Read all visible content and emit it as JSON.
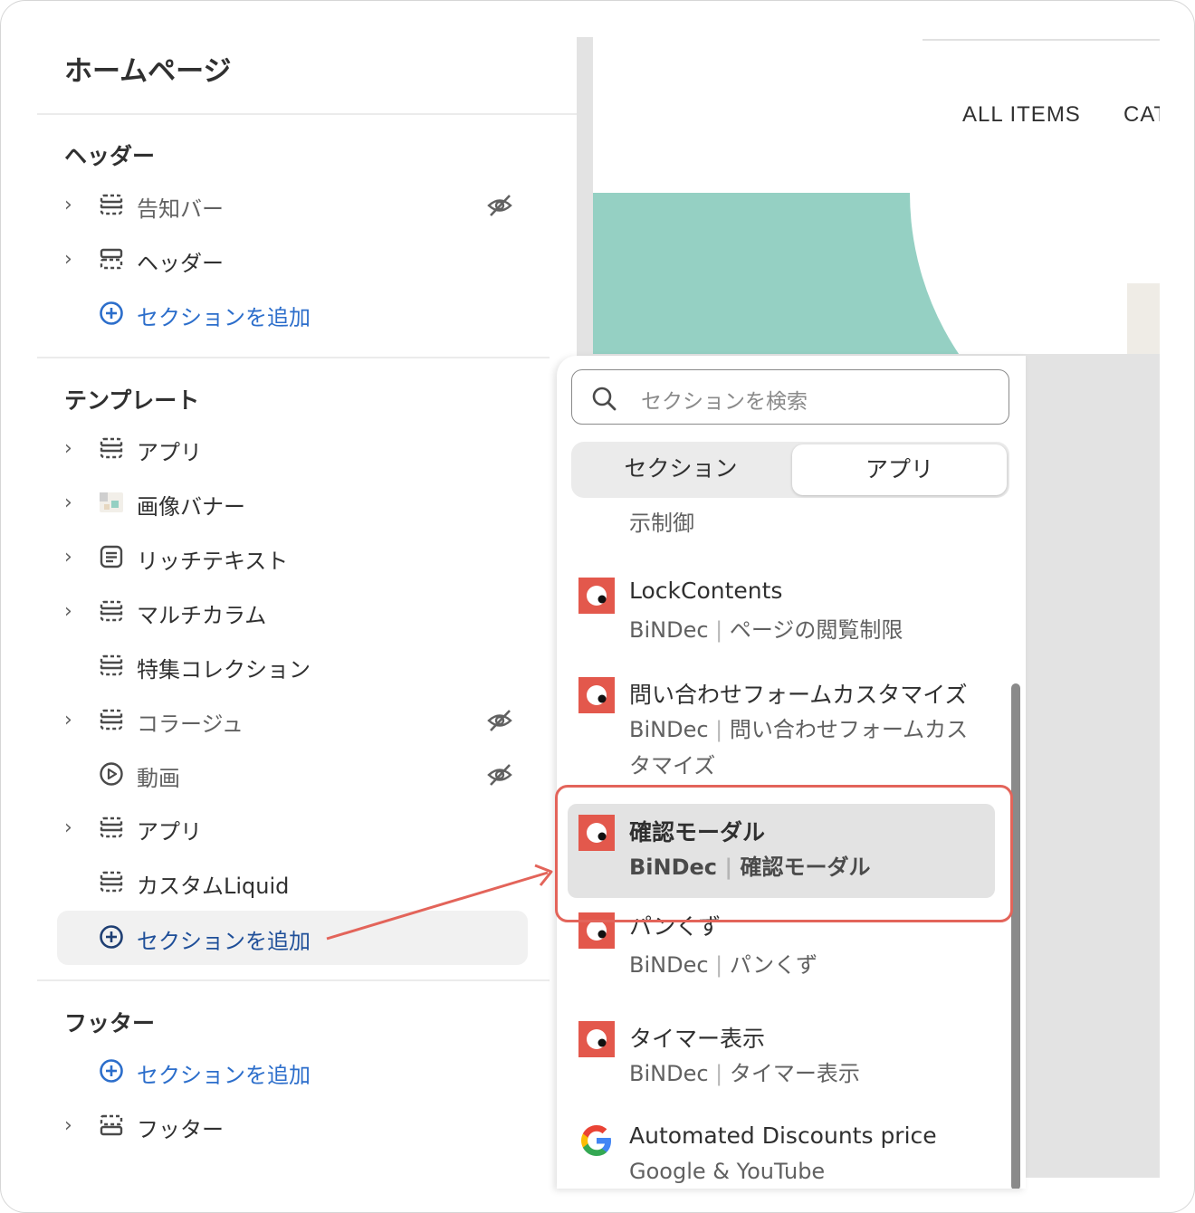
{
  "editor": {
    "page_title": "ホームページ",
    "groups": [
      {
        "title": "ヘッダー",
        "items": [
          {
            "label": "告知バー",
            "hidden": true,
            "expandable": true,
            "icon": "section-icon"
          },
          {
            "label": "ヘッダー",
            "hidden": false,
            "expandable": true,
            "icon": "header-section-icon"
          }
        ],
        "add_label": "セクションを追加"
      },
      {
        "title": "テンプレート",
        "items": [
          {
            "label": "アプリ",
            "hidden": false,
            "expandable": true,
            "icon": "section-icon"
          },
          {
            "label": "画像バナー",
            "hidden": false,
            "expandable": true,
            "icon": "image-thumbnail-icon"
          },
          {
            "label": "リッチテキスト",
            "hidden": false,
            "expandable": true,
            "icon": "text-icon"
          },
          {
            "label": "マルチカラム",
            "hidden": false,
            "expandable": true,
            "icon": "section-icon"
          },
          {
            "label": "特集コレクション",
            "hidden": false,
            "expandable": false,
            "icon": "section-icon"
          },
          {
            "label": "コラージュ",
            "hidden": true,
            "expandable": true,
            "icon": "section-icon"
          },
          {
            "label": "動画",
            "hidden": true,
            "expandable": false,
            "icon": "play-icon"
          },
          {
            "label": "アプリ",
            "hidden": false,
            "expandable": true,
            "icon": "section-icon"
          },
          {
            "label": "カスタムLiquid",
            "hidden": false,
            "expandable": false,
            "icon": "section-icon"
          }
        ],
        "add_label": "セクションを追加"
      },
      {
        "title": "フッター",
        "add_label": "セクションを追加",
        "items": [
          {
            "label": "フッター",
            "hidden": false,
            "expandable": true,
            "icon": "footer-section-icon"
          }
        ]
      }
    ]
  },
  "preview": {
    "nav": [
      "ALL ITEMS",
      "CAT"
    ]
  },
  "popover": {
    "search_placeholder": "セクションを検索",
    "tabs": [
      "セクション",
      "アプリ"
    ],
    "selected_tab": 1,
    "truncated_item_sub": "示制御",
    "apps": [
      {
        "name": "LockContents",
        "vendor": "BiNDec",
        "desc": "ページの閲覧制限",
        "logo": "bindec-logo-icon"
      },
      {
        "name": "問い合わせフォームカスタマイズ",
        "vendor": "BiNDec",
        "desc": "問い合わせフォームカスタマイズ",
        "logo": "bindec-logo-icon"
      },
      {
        "name": "確認モーダル",
        "vendor": "BiNDec",
        "desc": "確認モーダル",
        "logo": "bindec-logo-icon",
        "highlighted": true
      },
      {
        "name": "パンくず",
        "vendor": "BiNDec",
        "desc": "パンくず",
        "logo": "bindec-logo-icon"
      },
      {
        "name": "タイマー表示",
        "vendor": "BiNDec",
        "desc": "タイマー表示",
        "logo": "bindec-logo-icon"
      },
      {
        "name": "Automated Discounts price",
        "vendor": "Google & YouTube",
        "desc": "",
        "logo": "google-logo-icon"
      }
    ],
    "separator": "|"
  },
  "colors": {
    "link_blue": "#2c6ecb",
    "annotation_red": "#e3645a",
    "bindec_red": "#e3584c",
    "hero_teal": "#95d0c3"
  }
}
